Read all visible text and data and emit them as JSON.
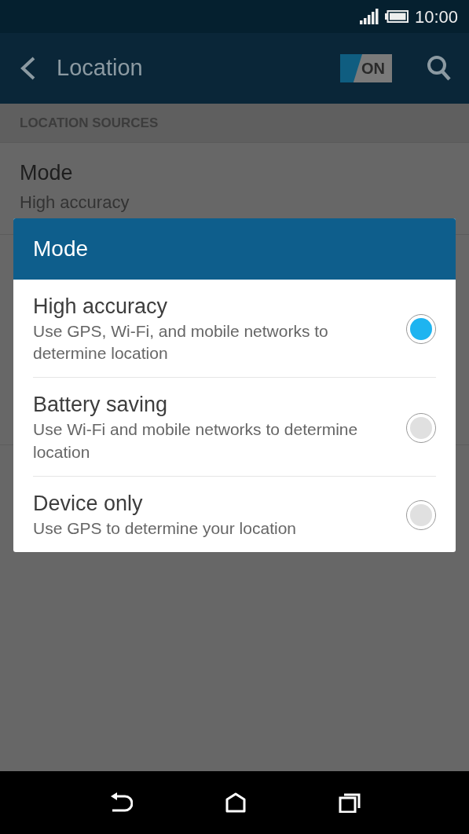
{
  "status_bar": {
    "time": "10:00"
  },
  "app_bar": {
    "title": "Location",
    "toggle": {
      "label": "ON",
      "on": true
    }
  },
  "section_header": "LOCATION SOURCES",
  "settings": [
    {
      "title": "Mode",
      "summary": "High accuracy"
    }
  ],
  "dialog": {
    "title": "Mode",
    "options": [
      {
        "title": "High accuracy",
        "description": "Use GPS, Wi-Fi, and mobile networks to determine location",
        "selected": true
      },
      {
        "title": "Battery saving",
        "description": "Use Wi-Fi and mobile networks to determine location",
        "selected": false
      },
      {
        "title": "Device only",
        "description": "Use GPS to determine your location",
        "selected": false
      }
    ]
  }
}
